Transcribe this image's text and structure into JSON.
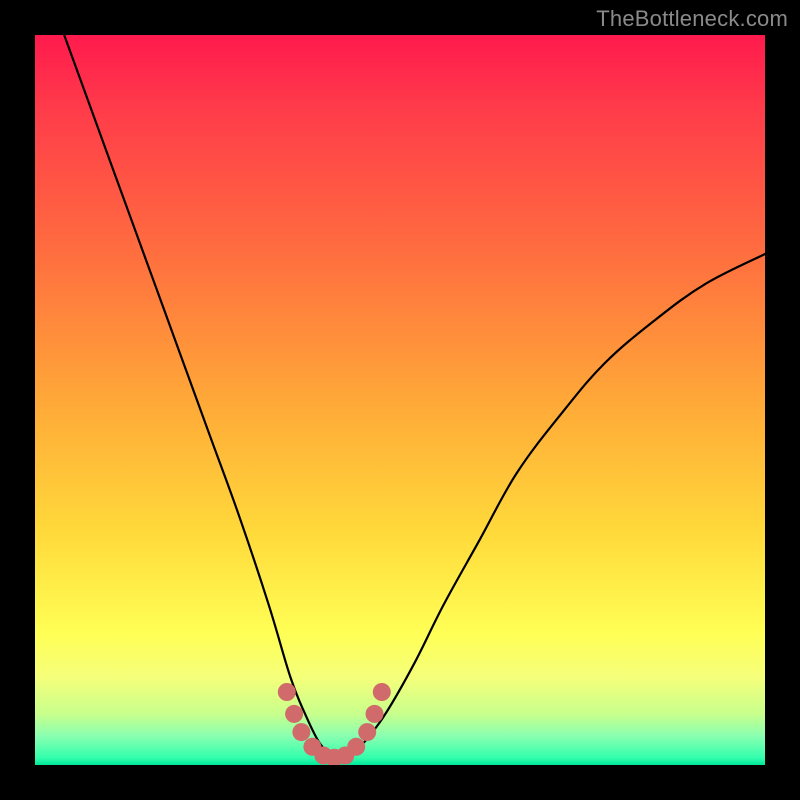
{
  "watermark": "TheBottleneck.com",
  "chart_data": {
    "type": "line",
    "title": "",
    "xlabel": "",
    "ylabel": "",
    "xlim": [
      0,
      100
    ],
    "ylim": [
      0,
      100
    ],
    "series": [
      {
        "name": "bottleneck-curve",
        "x": [
          4,
          8,
          12,
          16,
          20,
          24,
          28,
          32,
          35,
          37,
          39,
          41,
          43,
          45,
          48,
          52,
          56,
          61,
          66,
          72,
          78,
          85,
          92,
          100
        ],
        "y": [
          100,
          89,
          78,
          67,
          56,
          45,
          34,
          22,
          12,
          7,
          3,
          1,
          1,
          3,
          7,
          14,
          22,
          31,
          40,
          48,
          55,
          61,
          66,
          70
        ]
      }
    ],
    "markers": {
      "name": "highlight-dots",
      "color": "#d16a6a",
      "points": [
        {
          "x": 34.5,
          "y": 10
        },
        {
          "x": 35.5,
          "y": 7
        },
        {
          "x": 36.5,
          "y": 4.5
        },
        {
          "x": 38,
          "y": 2.5
        },
        {
          "x": 39.5,
          "y": 1.3
        },
        {
          "x": 41,
          "y": 1
        },
        {
          "x": 42.5,
          "y": 1.3
        },
        {
          "x": 44,
          "y": 2.5
        },
        {
          "x": 45.5,
          "y": 4.5
        },
        {
          "x": 46.5,
          "y": 7
        },
        {
          "x": 47.5,
          "y": 10
        }
      ]
    },
    "gradient_stops": [
      {
        "pos": 0,
        "color": "#ff1a4d"
      },
      {
        "pos": 50,
        "color": "#ffa838"
      },
      {
        "pos": 82,
        "color": "#ffff55"
      },
      {
        "pos": 100,
        "color": "#00e69a"
      }
    ]
  }
}
